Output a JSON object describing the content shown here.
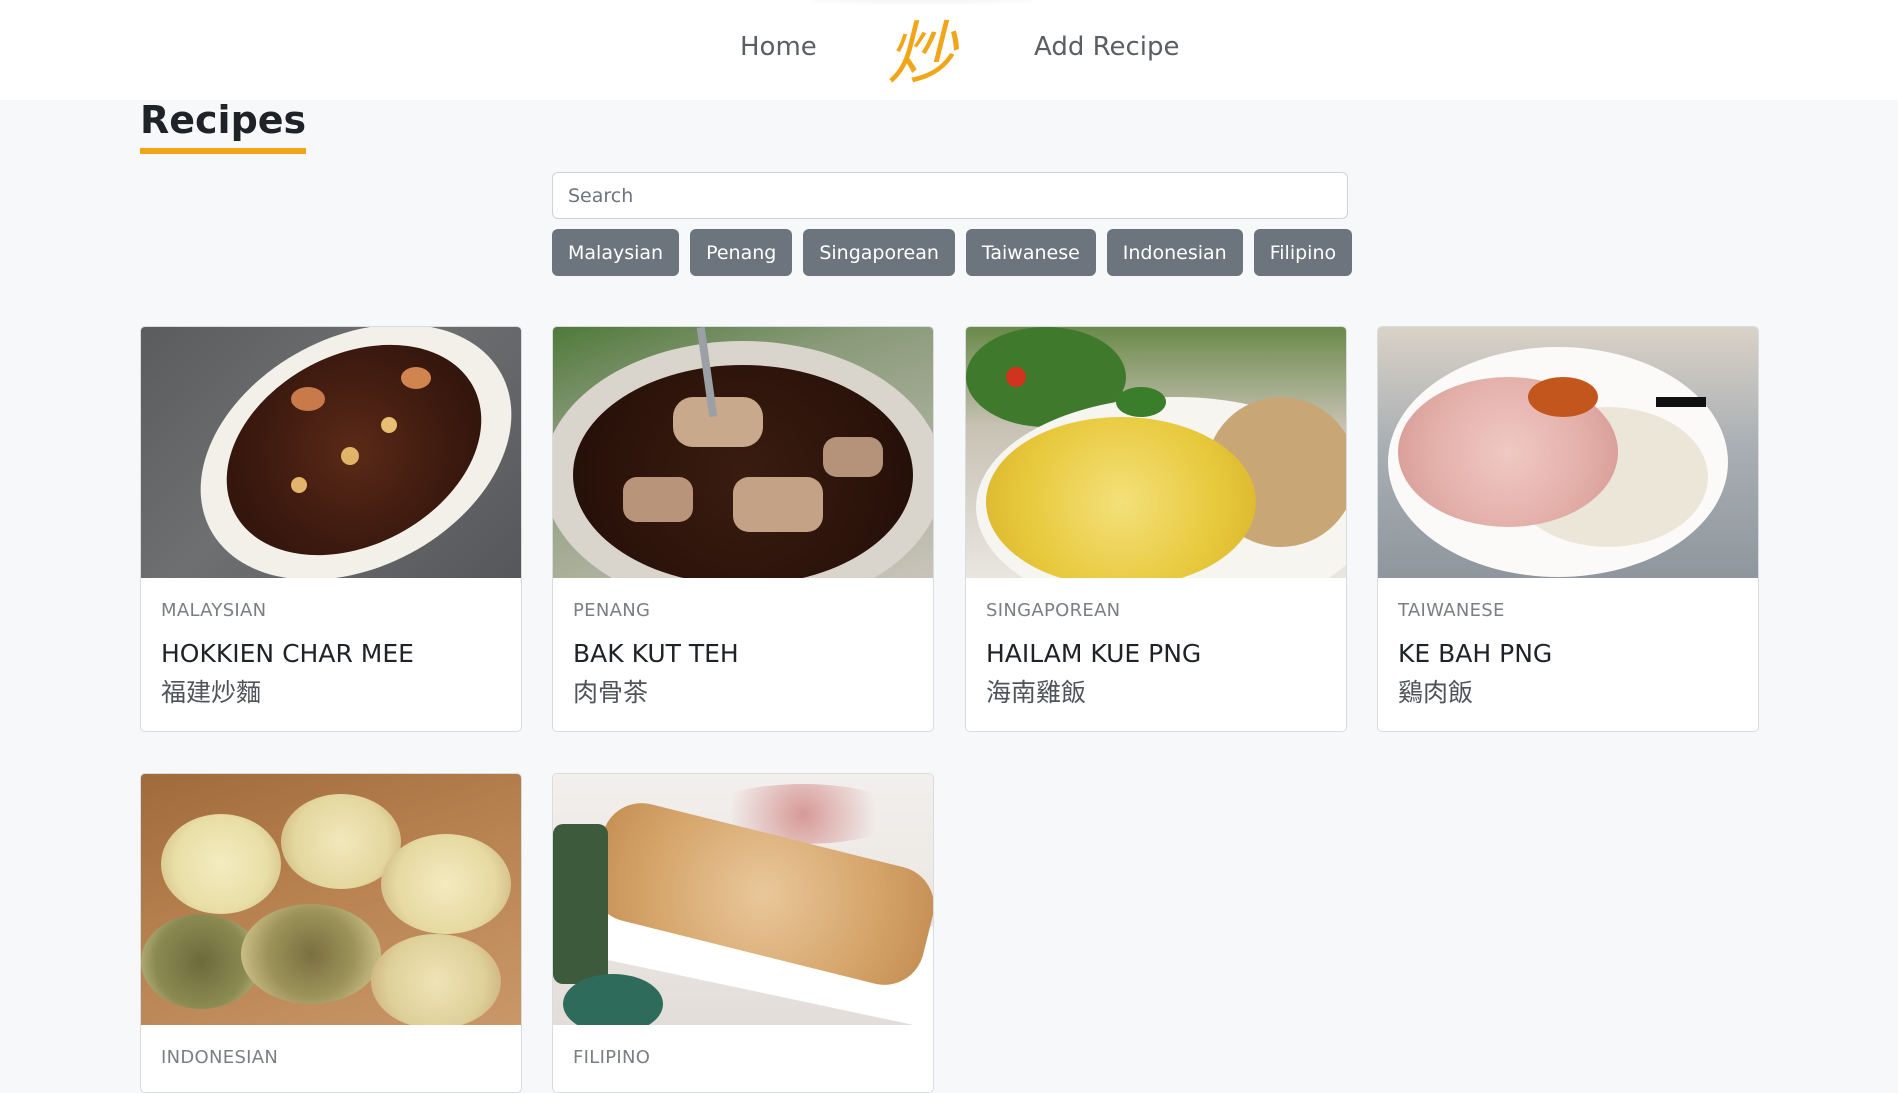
{
  "nav": {
    "home_label": "Home",
    "logo_text": "炒",
    "add_recipe_label": "Add Recipe"
  },
  "page": {
    "title": "Recipes"
  },
  "search": {
    "placeholder": "Search",
    "value": ""
  },
  "filters": [
    "Malaysian",
    "Penang",
    "Singaporean",
    "Taiwanese",
    "Indonesian",
    "Filipino"
  ],
  "recipes": [
    {
      "cuisine": "MALAYSIAN",
      "name": "HOKKIEN CHAR MEE",
      "chinese": "福建炒麵",
      "image_icon": "hokkien-char-mee-photo"
    },
    {
      "cuisine": "PENANG",
      "name": "BAK KUT TEH",
      "chinese": "肉骨茶",
      "image_icon": "bak-kut-teh-photo"
    },
    {
      "cuisine": "SINGAPOREAN",
      "name": "HAILAM KUE PNG",
      "chinese": "海南雞飯",
      "image_icon": "hailam-kue-png-photo"
    },
    {
      "cuisine": "TAIWANESE",
      "name": "KE BAH PNG",
      "chinese": "鷄肉飯",
      "image_icon": "ke-bah-png-photo"
    },
    {
      "cuisine": "INDONESIAN",
      "name": "",
      "chinese": "",
      "image_icon": "indonesian-pastry-photo"
    },
    {
      "cuisine": "FILIPINO",
      "name": "",
      "chinese": "",
      "image_icon": "filipino-dessert-photo"
    }
  ],
  "colors": {
    "accent": "#f2a516",
    "filter_bg": "#6c757d",
    "page_bg": "#f7f8f9"
  }
}
